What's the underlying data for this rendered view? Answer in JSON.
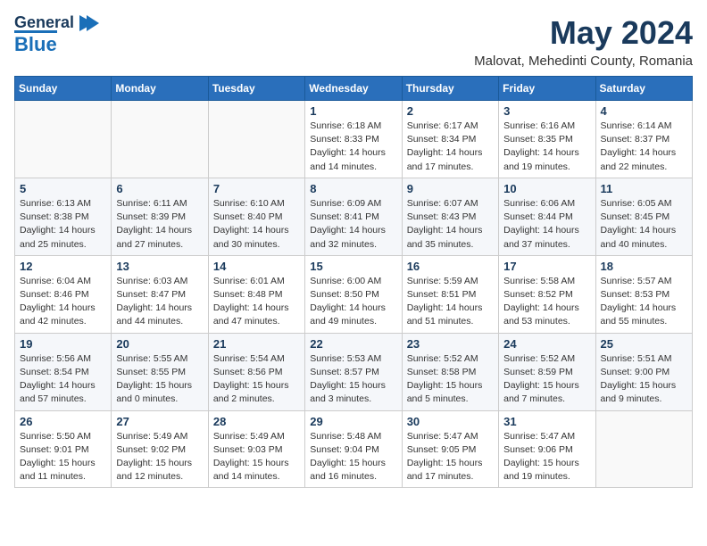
{
  "header": {
    "logo_line1": "General",
    "logo_line2": "Blue",
    "title": "May 2024",
    "subtitle": "Malovat, Mehedinti County, Romania"
  },
  "days_of_week": [
    "Sunday",
    "Monday",
    "Tuesday",
    "Wednesday",
    "Thursday",
    "Friday",
    "Saturday"
  ],
  "weeks": [
    [
      {
        "day": "",
        "info": ""
      },
      {
        "day": "",
        "info": ""
      },
      {
        "day": "",
        "info": ""
      },
      {
        "day": "1",
        "info": "Sunrise: 6:18 AM\nSunset: 8:33 PM\nDaylight: 14 hours\nand 14 minutes."
      },
      {
        "day": "2",
        "info": "Sunrise: 6:17 AM\nSunset: 8:34 PM\nDaylight: 14 hours\nand 17 minutes."
      },
      {
        "day": "3",
        "info": "Sunrise: 6:16 AM\nSunset: 8:35 PM\nDaylight: 14 hours\nand 19 minutes."
      },
      {
        "day": "4",
        "info": "Sunrise: 6:14 AM\nSunset: 8:37 PM\nDaylight: 14 hours\nand 22 minutes."
      }
    ],
    [
      {
        "day": "5",
        "info": "Sunrise: 6:13 AM\nSunset: 8:38 PM\nDaylight: 14 hours\nand 25 minutes."
      },
      {
        "day": "6",
        "info": "Sunrise: 6:11 AM\nSunset: 8:39 PM\nDaylight: 14 hours\nand 27 minutes."
      },
      {
        "day": "7",
        "info": "Sunrise: 6:10 AM\nSunset: 8:40 PM\nDaylight: 14 hours\nand 30 minutes."
      },
      {
        "day": "8",
        "info": "Sunrise: 6:09 AM\nSunset: 8:41 PM\nDaylight: 14 hours\nand 32 minutes."
      },
      {
        "day": "9",
        "info": "Sunrise: 6:07 AM\nSunset: 8:43 PM\nDaylight: 14 hours\nand 35 minutes."
      },
      {
        "day": "10",
        "info": "Sunrise: 6:06 AM\nSunset: 8:44 PM\nDaylight: 14 hours\nand 37 minutes."
      },
      {
        "day": "11",
        "info": "Sunrise: 6:05 AM\nSunset: 8:45 PM\nDaylight: 14 hours\nand 40 minutes."
      }
    ],
    [
      {
        "day": "12",
        "info": "Sunrise: 6:04 AM\nSunset: 8:46 PM\nDaylight: 14 hours\nand 42 minutes."
      },
      {
        "day": "13",
        "info": "Sunrise: 6:03 AM\nSunset: 8:47 PM\nDaylight: 14 hours\nand 44 minutes."
      },
      {
        "day": "14",
        "info": "Sunrise: 6:01 AM\nSunset: 8:48 PM\nDaylight: 14 hours\nand 47 minutes."
      },
      {
        "day": "15",
        "info": "Sunrise: 6:00 AM\nSunset: 8:50 PM\nDaylight: 14 hours\nand 49 minutes."
      },
      {
        "day": "16",
        "info": "Sunrise: 5:59 AM\nSunset: 8:51 PM\nDaylight: 14 hours\nand 51 minutes."
      },
      {
        "day": "17",
        "info": "Sunrise: 5:58 AM\nSunset: 8:52 PM\nDaylight: 14 hours\nand 53 minutes."
      },
      {
        "day": "18",
        "info": "Sunrise: 5:57 AM\nSunset: 8:53 PM\nDaylight: 14 hours\nand 55 minutes."
      }
    ],
    [
      {
        "day": "19",
        "info": "Sunrise: 5:56 AM\nSunset: 8:54 PM\nDaylight: 14 hours\nand 57 minutes."
      },
      {
        "day": "20",
        "info": "Sunrise: 5:55 AM\nSunset: 8:55 PM\nDaylight: 15 hours\nand 0 minutes."
      },
      {
        "day": "21",
        "info": "Sunrise: 5:54 AM\nSunset: 8:56 PM\nDaylight: 15 hours\nand 2 minutes."
      },
      {
        "day": "22",
        "info": "Sunrise: 5:53 AM\nSunset: 8:57 PM\nDaylight: 15 hours\nand 3 minutes."
      },
      {
        "day": "23",
        "info": "Sunrise: 5:52 AM\nSunset: 8:58 PM\nDaylight: 15 hours\nand 5 minutes."
      },
      {
        "day": "24",
        "info": "Sunrise: 5:52 AM\nSunset: 8:59 PM\nDaylight: 15 hours\nand 7 minutes."
      },
      {
        "day": "25",
        "info": "Sunrise: 5:51 AM\nSunset: 9:00 PM\nDaylight: 15 hours\nand 9 minutes."
      }
    ],
    [
      {
        "day": "26",
        "info": "Sunrise: 5:50 AM\nSunset: 9:01 PM\nDaylight: 15 hours\nand 11 minutes."
      },
      {
        "day": "27",
        "info": "Sunrise: 5:49 AM\nSunset: 9:02 PM\nDaylight: 15 hours\nand 12 minutes."
      },
      {
        "day": "28",
        "info": "Sunrise: 5:49 AM\nSunset: 9:03 PM\nDaylight: 15 hours\nand 14 minutes."
      },
      {
        "day": "29",
        "info": "Sunrise: 5:48 AM\nSunset: 9:04 PM\nDaylight: 15 hours\nand 16 minutes."
      },
      {
        "day": "30",
        "info": "Sunrise: 5:47 AM\nSunset: 9:05 PM\nDaylight: 15 hours\nand 17 minutes."
      },
      {
        "day": "31",
        "info": "Sunrise: 5:47 AM\nSunset: 9:06 PM\nDaylight: 15 hours\nand 19 minutes."
      },
      {
        "day": "",
        "info": ""
      }
    ]
  ]
}
